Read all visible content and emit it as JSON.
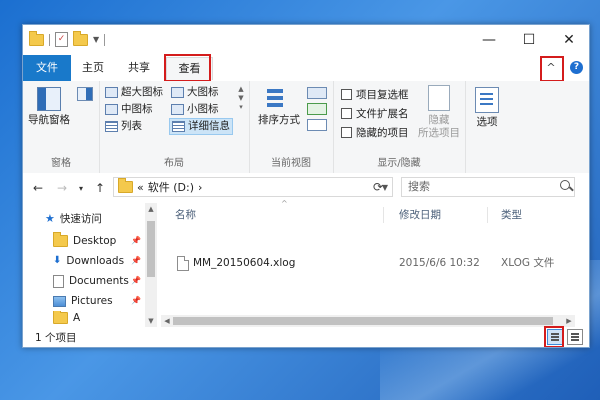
{
  "colors": {
    "file_tab_bg": "#1979ca",
    "highlight": "#d41c1c",
    "desktop": "#1b6fd0"
  },
  "titlebar": {
    "minimize": "—",
    "maximize": "☐",
    "close": "✕"
  },
  "tabs": {
    "file": "文件",
    "home": "主页",
    "share": "共享",
    "view": "查看"
  },
  "ribbon": {
    "collapse_icon": "^",
    "help_icon": "?",
    "panes": {
      "nav_pane": "导航窗格",
      "group_label": "窗格"
    },
    "layout": {
      "items": [
        "超大图标",
        "大图标",
        "中图标",
        "小图标",
        "列表",
        "详细信息"
      ],
      "group_label": "布局"
    },
    "current_view": {
      "sort_by": "排序方式",
      "group_label": "当前视图"
    },
    "show_hide": {
      "checkbox_items": "项目复选框",
      "file_ext": "文件扩展名",
      "hidden_items": "隐藏的项目",
      "hide_selected_line1": "隐藏",
      "hide_selected_line2": "所选项目",
      "group_label": "显示/隐藏"
    },
    "options": "选项"
  },
  "address": {
    "prefix": "«",
    "path": "软件 (D:)",
    "chevron": "›"
  },
  "search": {
    "placeholder": "搜索"
  },
  "nav_pane": {
    "items": [
      {
        "label": "快速访问",
        "icon": "star-icon"
      },
      {
        "label": "Desktop",
        "icon": "folder-icon"
      },
      {
        "label": "Downloads",
        "icon": "download-icon"
      },
      {
        "label": "Documents",
        "icon": "document-icon"
      },
      {
        "label": "Pictures",
        "icon": "pictures-icon"
      },
      {
        "label": "A",
        "icon": "folder-icon"
      }
    ]
  },
  "file_list": {
    "columns": {
      "name": "名称",
      "modified": "修改日期",
      "type": "类型"
    },
    "rows": [
      {
        "name": "MM_20150604.xlog",
        "modified": "2015/6/6 10:32",
        "type": "XLOG 文件"
      }
    ]
  },
  "status": {
    "item_count": "1 个项目"
  }
}
